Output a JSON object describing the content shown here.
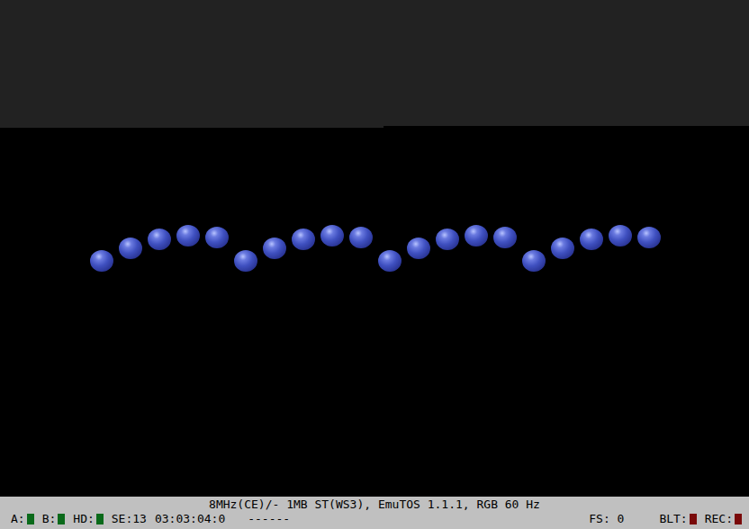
{
  "status_bar": {
    "info": "8MHz(CE)/- 1MB ST(WS3), EmuTOS 1.1.1, RGB 60 Hz",
    "indicators": [
      {
        "label": "A:",
        "color": "#0a6a1a"
      },
      {
        "label": "B:",
        "color": "#0a6a1a"
      },
      {
        "label": "HD:",
        "color": "#0a6a1a"
      }
    ],
    "sector": "SE:13",
    "time": "03:03:04:0",
    "activity": "------",
    "frameskip": "FS: 0",
    "right_indicators": [
      {
        "label": "BLT:",
        "color": "#7a0a0a"
      },
      {
        "label": "REC:",
        "color": "#7a0a0a"
      }
    ]
  }
}
